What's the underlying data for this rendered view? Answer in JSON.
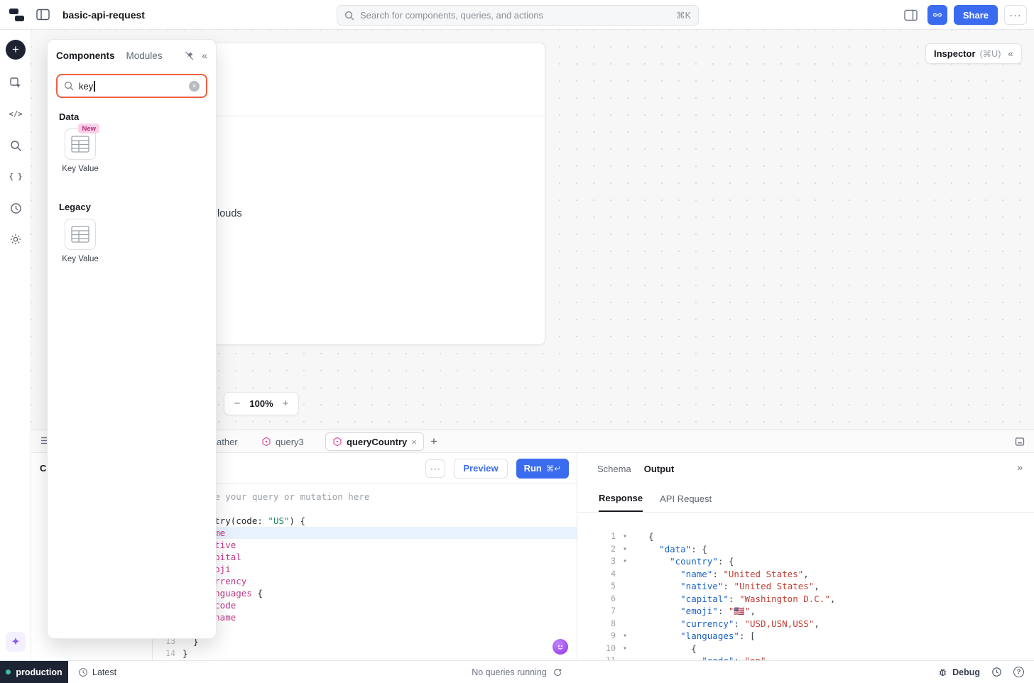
{
  "colors": {
    "accent": "#3b6cf0",
    "magenta": "#d6409f",
    "env_dot": "#3fbf9f",
    "search_focus": "#ee5f3e"
  },
  "topbar": {
    "title": "basic-api-request",
    "search_placeholder": "Search for components, queries, and actions",
    "search_shortcut": "⌘K",
    "share": "Share",
    "more": "···"
  },
  "inspector": {
    "label": "Inspector",
    "shortcut": "(⌘U)",
    "collapse": "«"
  },
  "components_panel": {
    "tab_components": "Components",
    "tab_modules": "Modules",
    "collapse": "«",
    "search_value": "key",
    "section_data": "Data",
    "section_legacy": "Legacy",
    "card_data": {
      "label": "Key Value",
      "badge": "New"
    },
    "card_legacy": {
      "label": "Key Value"
    }
  },
  "canvas": {
    "frame_fragment": "louds",
    "zoom_out": "−",
    "zoom_level": "100%",
    "zoom_in": "+"
  },
  "query_tabs": {
    "tab1": "ather",
    "tab2": "query3",
    "tab3": "queryCountry",
    "close": "×",
    "add": "+"
  },
  "query_editor": {
    "left_header_fragment": "C",
    "more": "···",
    "preview": "Preview",
    "run": "Run",
    "run_shortcut": "⌘↵",
    "code_lines": [
      {
        "n": "",
        "t": [
          [
            "      e your query or mutation here",
            "cm"
          ]
        ]
      },
      {
        "n": "",
        "t": []
      },
      {
        "n": "",
        "t": [
          [
            "      try(code: ",
            "pl"
          ],
          [
            "\"US\"",
            "gs"
          ],
          [
            ") {",
            "pl"
          ]
        ]
      },
      {
        "n": "",
        "hl": true,
        "t": [
          [
            "      me",
            "fd"
          ]
        ]
      },
      {
        "n": "",
        "t": [
          [
            "      tive",
            "fd"
          ]
        ]
      },
      {
        "n": "",
        "t": [
          [
            "      pital",
            "fd"
          ]
        ]
      },
      {
        "n": "",
        "t": [
          [
            "      oji",
            "fd"
          ]
        ]
      },
      {
        "n": "",
        "t": [
          [
            "      rrency",
            "fd"
          ]
        ]
      },
      {
        "n": "",
        "t": [
          [
            "      nguages",
            "fd"
          ],
          [
            " {",
            "pl"
          ]
        ]
      },
      {
        "n": "",
        "t": [
          [
            "      code",
            "fd"
          ]
        ]
      },
      {
        "n": "",
        "t": [
          [
            "      name",
            "fd"
          ]
        ]
      },
      {
        "n": "",
        "t": []
      },
      {
        "n": "13",
        "t": [
          [
            "  }",
            "pl"
          ]
        ]
      },
      {
        "n": "14",
        "t": [
          [
            "}",
            "pl"
          ]
        ]
      }
    ]
  },
  "response_panel": {
    "tab_schema": "Schema",
    "tab_output": "Output",
    "expand": "»",
    "subtab_response": "Response",
    "subtab_api": "API Request",
    "json_lines": [
      {
        "n": "1",
        "a": true,
        "t": [
          [
            "{",
            "pu"
          ]
        ]
      },
      {
        "n": "2",
        "a": true,
        "t": [
          [
            "  ",
            "pu"
          ],
          [
            "\"data\"",
            "ky"
          ],
          [
            ": {",
            "pu"
          ]
        ]
      },
      {
        "n": "3",
        "a": true,
        "t": [
          [
            "    ",
            "pu"
          ],
          [
            "\"country\"",
            "ky"
          ],
          [
            ": {",
            "pu"
          ]
        ]
      },
      {
        "n": "4",
        "t": [
          [
            "      ",
            "pu"
          ],
          [
            "\"name\"",
            "ky"
          ],
          [
            ": ",
            "pu"
          ],
          [
            "\"United States\"",
            "st"
          ],
          [
            ",",
            "pu"
          ]
        ]
      },
      {
        "n": "5",
        "t": [
          [
            "      ",
            "pu"
          ],
          [
            "\"native\"",
            "ky"
          ],
          [
            ": ",
            "pu"
          ],
          [
            "\"United States\"",
            "st"
          ],
          [
            ",",
            "pu"
          ]
        ]
      },
      {
        "n": "6",
        "t": [
          [
            "      ",
            "pu"
          ],
          [
            "\"capital\"",
            "ky"
          ],
          [
            ": ",
            "pu"
          ],
          [
            "\"Washington D.C.\"",
            "st"
          ],
          [
            ",",
            "pu"
          ]
        ]
      },
      {
        "n": "7",
        "t": [
          [
            "      ",
            "pu"
          ],
          [
            "\"emoji\"",
            "ky"
          ],
          [
            ": ",
            "pu"
          ],
          [
            "\"🇺🇸\"",
            "st"
          ],
          [
            ",",
            "pu"
          ]
        ]
      },
      {
        "n": "8",
        "t": [
          [
            "      ",
            "pu"
          ],
          [
            "\"currency\"",
            "ky"
          ],
          [
            ": ",
            "pu"
          ],
          [
            "\"USD,USN,USS\"",
            "st"
          ],
          [
            ",",
            "pu"
          ]
        ]
      },
      {
        "n": "9",
        "a": true,
        "t": [
          [
            "      ",
            "pu"
          ],
          [
            "\"languages\"",
            "ky"
          ],
          [
            ": [",
            "pu"
          ]
        ]
      },
      {
        "n": "10",
        "a": true,
        "t": [
          [
            "        {",
            "pu"
          ]
        ]
      },
      {
        "n": "11",
        "t": [
          [
            "          ",
            "pu"
          ],
          [
            "\"code\"",
            "ky"
          ],
          [
            ": ",
            "pu"
          ],
          [
            "\"en\"",
            "st"
          ]
        ]
      }
    ]
  },
  "statusbar": {
    "environment": "production",
    "version": "Latest",
    "queries_status": "No queries running",
    "debug": "Debug"
  }
}
